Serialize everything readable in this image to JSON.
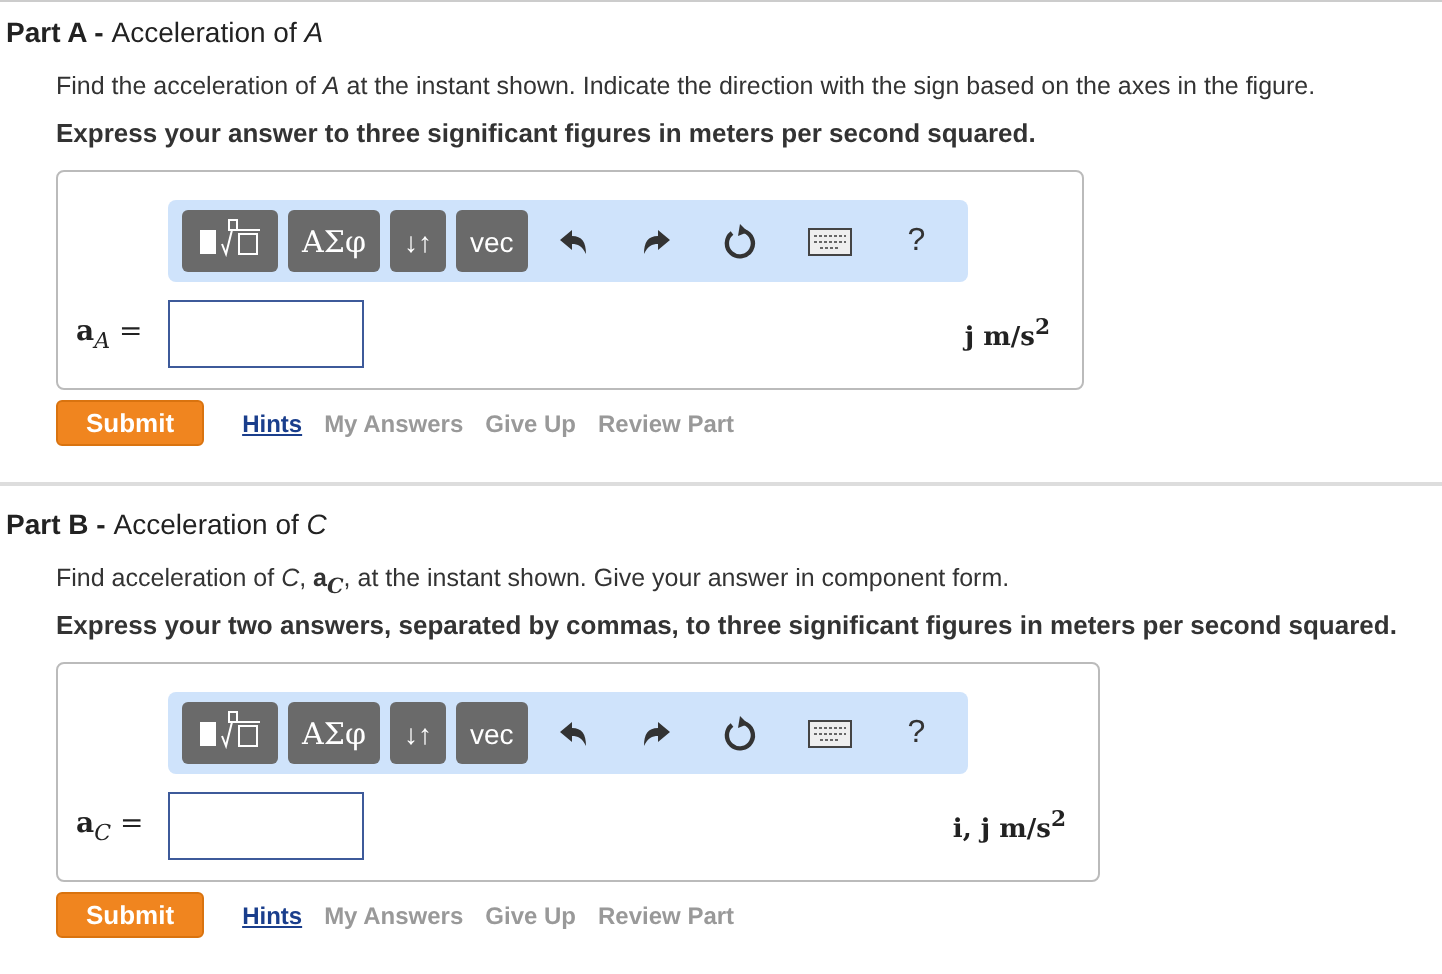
{
  "parts": [
    {
      "label": "Part A -",
      "title": "Acceleration of *A*",
      "prompt": "Find the acceleration of *A* at the instant shown. Indicate the direction with the sign based on the axes in the figure.",
      "instruction": "Express your answer to three significant figures in meters per second squared.",
      "toolbar": [
        "ΑΣφ",
        "↓↑",
        "vec",
        "?"
      ],
      "variable": "**a**$_{A}$ =",
      "units": "j m/s$^{2}$",
      "submit": "Submit",
      "links": [
        {
          "label": "Hints",
          "disabled": false
        },
        {
          "label": "My Answers",
          "disabled": true
        },
        {
          "label": "Give Up",
          "disabled": true
        },
        {
          "label": "Review Part",
          "disabled": true
        }
      ]
    },
    {
      "label": "Part B -",
      "title": "Acceleration of *C*",
      "prompt": "Find acceleration of *C*, **a**$_{C}$, at the instant shown. Give your answer in component form.",
      "instruction": "Express your two answers, separated by commas, to three significant figures in meters per second squared.",
      "toolbar": [
        "ΑΣφ",
        "↓↑",
        "vec",
        "?"
      ],
      "variable": "**a**$_{C}$ =",
      "units": "i, j m/s$^{2}$",
      "submit": "Submit",
      "links": [
        {
          "label": "Hints",
          "disabled": false
        },
        {
          "label": "My Answers",
          "disabled": true
        },
        {
          "label": "Give Up",
          "disabled": true
        },
        {
          "label": "Review Part",
          "disabled": true
        }
      ]
    }
  ]
}
